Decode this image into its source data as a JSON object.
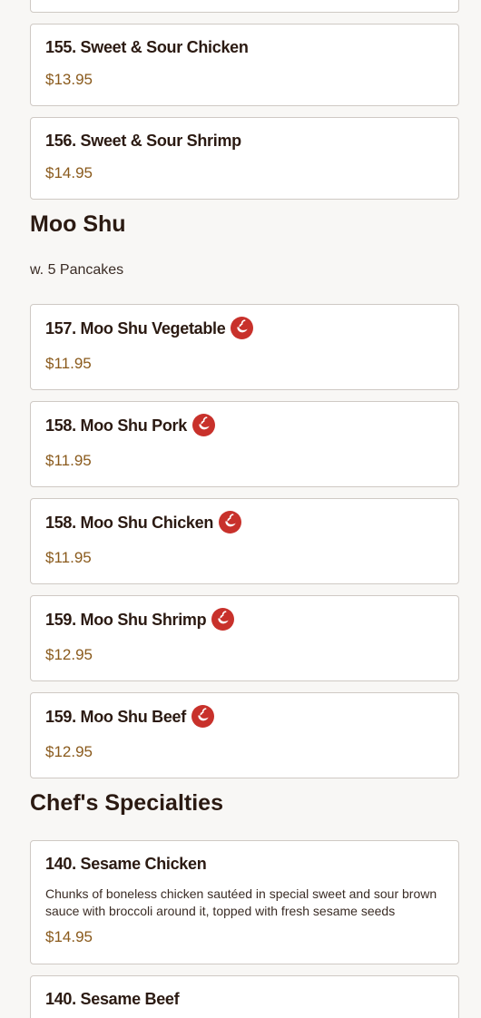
{
  "sections": {
    "sweet_sour": {
      "items": [
        {
          "title": "155. Sweet & Sour Chicken",
          "price": "$13.95"
        },
        {
          "title": "156. Sweet & Sour Shrimp",
          "price": "$14.95"
        }
      ]
    },
    "moo_shu": {
      "title": "Moo Shu",
      "subtitle": "w. 5 Pancakes",
      "items": [
        {
          "title": "157. Moo Shu Vegetable",
          "price": "$11.95",
          "spicy": true
        },
        {
          "title": "158. Moo Shu Pork",
          "price": "$11.95",
          "spicy": true
        },
        {
          "title": "158. Moo Shu Chicken",
          "price": "$11.95",
          "spicy": true
        },
        {
          "title": "159. Moo Shu Shrimp",
          "price": "$12.95",
          "spicy": true
        },
        {
          "title": "159. Moo Shu Beef",
          "price": "$12.95",
          "spicy": true
        }
      ]
    },
    "chefs": {
      "title": "Chef's Specialties",
      "items": [
        {
          "title": "140. Sesame Chicken",
          "description": "Chunks of boneless chicken sautéed in special sweet and sour brown sauce with broccoli around it, topped with fresh sesame seeds",
          "price": "$14.95"
        },
        {
          "title": "140. Sesame Beef"
        }
      ]
    }
  },
  "icons": {
    "spicy": "chili-pepper-icon"
  },
  "colors": {
    "background": "#f8f7f5",
    "price": "#8a5a1c",
    "spicy_badge": "#c8312b",
    "border": "#cfc9c4"
  }
}
